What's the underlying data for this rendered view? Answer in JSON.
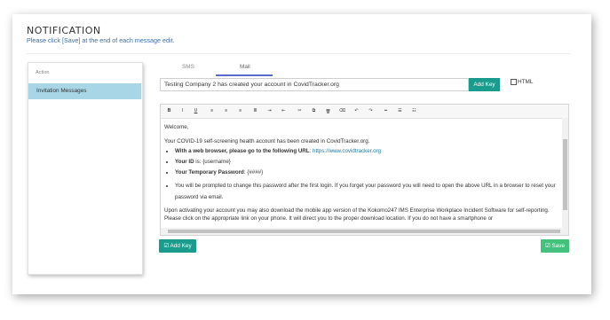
{
  "header": {
    "title": "NOTIFICATION",
    "subtitle": "Please click [Save] at the end of each message edit."
  },
  "sidebar": {
    "heading": "Action",
    "items": [
      {
        "label": "Invitation Messages",
        "selected": true
      }
    ]
  },
  "tabs": [
    {
      "label": "SMS",
      "active": false
    },
    {
      "label": "Mail",
      "active": true
    }
  ],
  "subject": {
    "value": "Testing Company 2 has created your account in CovidTracker.org"
  },
  "buttons": {
    "add_key_top": "Add Key",
    "add_key_bottom": "Add Key",
    "save": "Save"
  },
  "html_checkbox": {
    "label": "HTML",
    "checked": false
  },
  "toolbar": {
    "icons": [
      "bold-icon",
      "italic-icon",
      "underline-icon",
      "align-left-icon",
      "align-center-icon",
      "align-right-icon",
      "align-justify-icon",
      "indent-icon",
      "outdent-icon",
      "cut-icon",
      "copy-icon",
      "delete-icon",
      "eraser-icon",
      "undo-icon",
      "redo-icon",
      "horizontal-rule-icon",
      "bullet-list-icon",
      "numbered-list-icon"
    ],
    "labels": [
      "B",
      "I",
      "U",
      "≡",
      "≡",
      "≡",
      "≣",
      "⇥",
      "⇤",
      "✂",
      "⧉",
      "🗑",
      "⌫",
      "↶",
      "↷",
      "━",
      "☰",
      "☷"
    ]
  },
  "body": {
    "greeting": "Welcome,",
    "intro": "Your COVID-19 self-screening health account has been created in CovidTracker.org.",
    "web_label": "With a web browser, please go to the following URL",
    "web_url": "https://www.covidtracker.org",
    "id_label": "Your ID",
    "id_value": "is: {username}",
    "pw_label": "Your Temporary Password",
    "pw_value": ": {####}",
    "change_note": "You will be prompted to change this password after the first login.  If you forget your password you will need to open the above URL in a browser to reset your password via email.",
    "mobile_note": "Upon activating your account you may also download the mobile app version of the Kokomo247 IMS Enterprise Workplace Incident Software for self-reporting.  Please click on the appropriate link on your phone.  It will direct you to the proper download location.  If you do not have a smartphone or"
  },
  "colors": {
    "accent_teal": "#1a9c8c",
    "save_green": "#43c27d",
    "selected_row": "#a8d6e6",
    "tab_indicator": "#5a6acb",
    "link": "#1a7aa5"
  }
}
